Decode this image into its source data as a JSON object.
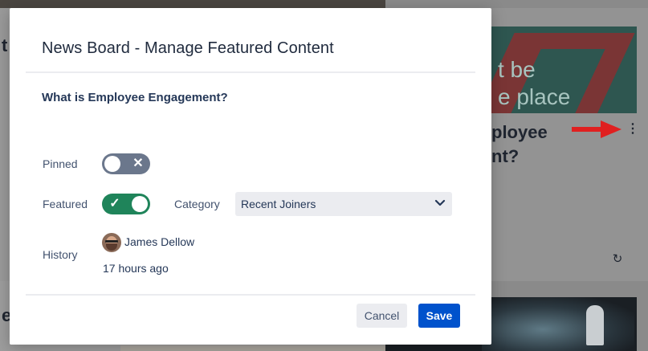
{
  "background": {
    "left_fragment_top": "t",
    "left_fragment_bottom": "e",
    "hero_text_line1": "t be",
    "hero_text_line2": "e place",
    "card_title_line1": "ployee",
    "card_title_line2": "nt?",
    "more_icon": "⋮",
    "refresh_icon": "↻",
    "arrow_color": "#e02020"
  },
  "modal": {
    "title": "News Board - Manage Featured Content",
    "item_title": "What is Employee Engagement?",
    "pinned": {
      "label": "Pinned",
      "state": "off",
      "glyph": "✕"
    },
    "featured": {
      "label": "Featured",
      "state": "on",
      "glyph": "✓"
    },
    "category": {
      "label": "Category",
      "value": "Recent Joiners"
    },
    "history": {
      "label": "History",
      "user": "James Dellow",
      "time": "17 hours ago"
    },
    "buttons": {
      "cancel": "Cancel",
      "save": "Save"
    }
  },
  "colors": {
    "toggle_on": "#1f845a",
    "toggle_off": "#6b778c",
    "primary_button": "#0052cc"
  }
}
